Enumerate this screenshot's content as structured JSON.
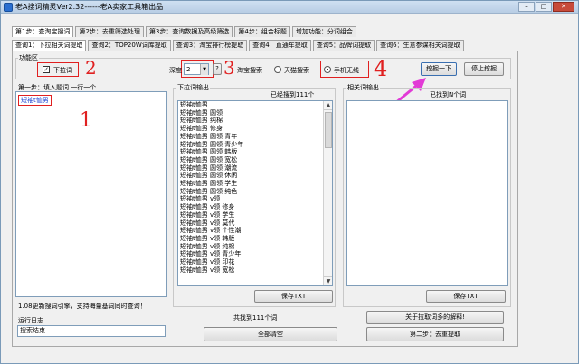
{
  "window": {
    "title": "老A搜词精灵Ver2.32------老A卖家工具箱出品"
  },
  "steps": [
    {
      "label": "第1步：查淘宝搜词",
      "active": true
    },
    {
      "label": "第2步：去重筛选处理",
      "active": false
    },
    {
      "label": "第3步：查询数据及高级筛选",
      "active": false
    },
    {
      "label": "第4步：组合标题",
      "active": false
    },
    {
      "label": "增加功能：分词组合",
      "active": false
    }
  ],
  "subtabs": [
    {
      "label": "查询1：下拉相关词提取",
      "active": true
    },
    {
      "label": "查询2：TOP20W词库提取",
      "active": false
    },
    {
      "label": "查询3：淘宝排行榜提取",
      "active": false
    },
    {
      "label": "查询4：直通车提取",
      "active": false
    },
    {
      "label": "查询5：品牌词提取",
      "active": false
    },
    {
      "label": "查询6：生意参谋相关词提取",
      "active": false
    }
  ],
  "func_area": {
    "label": "功能区",
    "checkbox_label": "下拉词",
    "depth_label": "深度",
    "depth_value": "2",
    "help": "?",
    "radio_taobao": "淘宝搜索",
    "radio_tmall": "天猫搜索",
    "radio_mobile": "手机无线",
    "dig_button": "挖掘一下",
    "stop_button": "停止挖掘"
  },
  "input_panel": {
    "label": "第一步：填入题词 一行一个",
    "keyword": "短袖t恤男",
    "footer": "1.08更新搜词引擎，支持海量基词同时查询！"
  },
  "dropdown_panel": {
    "label": "下拉词输出",
    "count": "已经搜到111个",
    "items": [
      "短袖t恤男",
      "短袖t恤男 圆领",
      "短袖t恤男 纯棉",
      "短袖t恤男 修身",
      "短袖t恤男 圆领 青年",
      "短袖t恤男 圆领 青少年",
      "短袖t恤男 圆领 韩版",
      "短袖t恤男 圆领 宽松",
      "短袖t恤男 圆领 潮流",
      "短袖t恤男 圆领 休闲",
      "短袖t恤男 圆领 学生",
      "短袖t恤男 圆领 纯色",
      "短袖t恤男 v领",
      "短袖t恤男 v领 修身",
      "短袖t恤男 v领 学生",
      "短袖t恤男 v领 莫代",
      "短袖t恤男 v领 个性潮",
      "短袖t恤男 v领 韩版",
      "短袖t恤男 v领 纯棉",
      "短袖t恤男 v领 青少年",
      "短袖t恤男 v领 印花",
      "短袖t恤男 v领 宽松"
    ],
    "save": "保存TXT",
    "total": "共找到111个词",
    "clear": "全部清空"
  },
  "related_panel": {
    "label": "相关词输出",
    "count": "已找到N个词",
    "save": "保存TXT",
    "about": "关于拉取词多的解释!",
    "next": "第二步：去重提取"
  },
  "log": {
    "label": "运行日志",
    "value": "搜索结束"
  },
  "annotations": {
    "n1": "1",
    "n2": "2",
    "n3": "3",
    "n4": "4"
  },
  "colors": {
    "annotation_red": "#e02020",
    "arrow_magenta": "#e23ad6",
    "keyword_blue": "#1a3fd0"
  }
}
